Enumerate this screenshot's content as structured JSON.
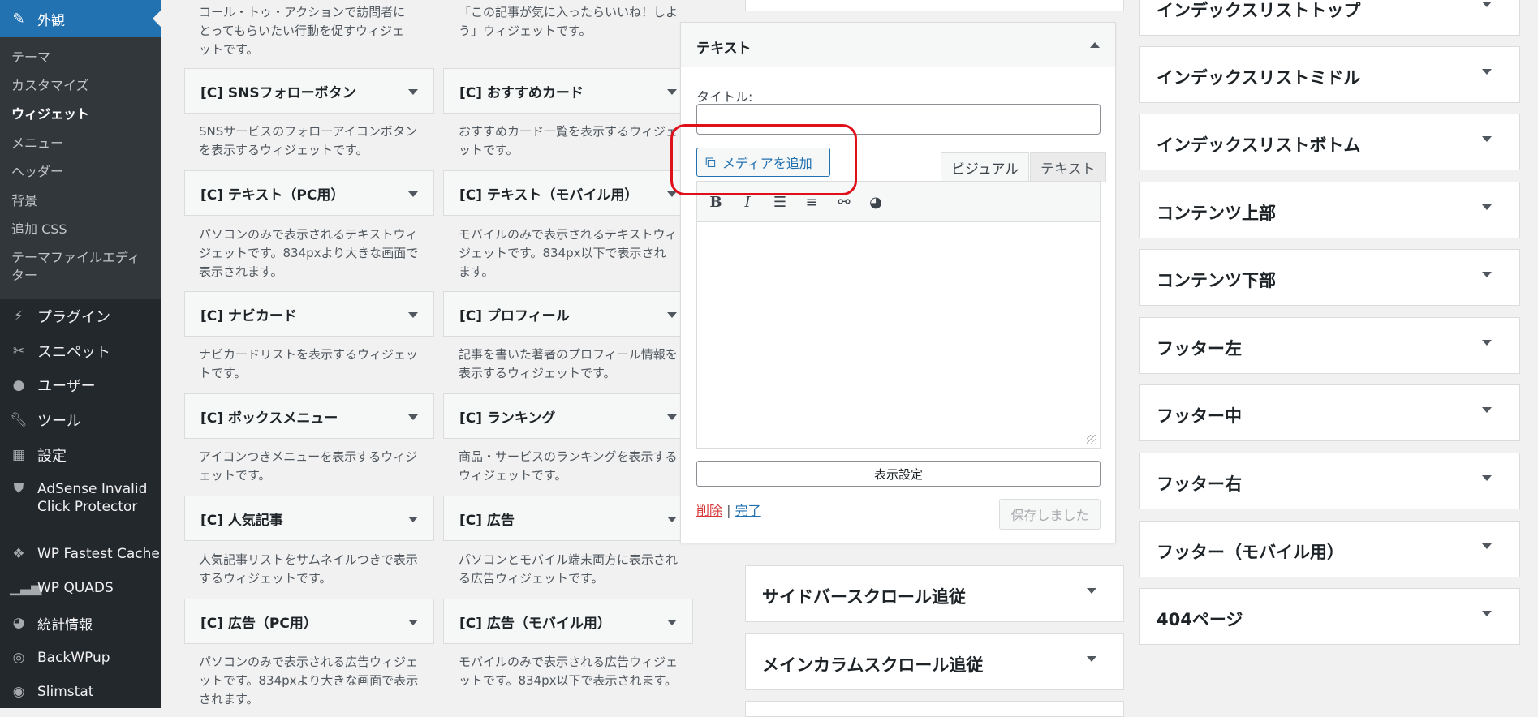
{
  "sidebar": {
    "active": {
      "label": "外観",
      "icon": "paintbrush-icon"
    },
    "submenu": [
      {
        "label": "テーマ"
      },
      {
        "label": "カスタマイズ"
      },
      {
        "label": "ウィジェット",
        "current": true
      },
      {
        "label": "メニュー"
      },
      {
        "label": "ヘッダー"
      },
      {
        "label": "背景"
      },
      {
        "label": "追加 CSS"
      },
      {
        "label": "テーマファイルエディター"
      }
    ],
    "items": [
      {
        "label": "プラグイン",
        "icon": "plugin-icon"
      },
      {
        "label": "スニペット",
        "icon": "scissors-icon"
      },
      {
        "label": "ユーザー",
        "icon": "user-icon"
      },
      {
        "label": "ツール",
        "icon": "wrench-icon"
      },
      {
        "label": "設定",
        "icon": "settings-icon"
      },
      {
        "label": "AdSense Invalid Click Protector",
        "icon": "shield-icon"
      },
      {
        "label": "WP Fastest Cache",
        "icon": "cheetah-icon"
      },
      {
        "label": "WP QUADS",
        "icon": "signal-bars-icon"
      },
      {
        "label": "統計情報",
        "icon": "pie-chart-icon"
      },
      {
        "label": "BackWPup",
        "icon": "backup-icon"
      },
      {
        "label": "Slimstat",
        "icon": "slimstat-icon"
      }
    ]
  },
  "widgets": {
    "top_desc_left": "コール・トゥ・アクションで訪問者にとってもらいたい行動を促すウィジェットです。",
    "top_desc_right": "「この記事が気に入ったらいいね！しよう」ウィジェットです。",
    "rows": [
      {
        "left": {
          "title": "[C] SNSフォローボタン",
          "desc": "SNSサービスのフォローアイコンボタンを表示するウィジェットです。"
        },
        "right": {
          "title": "[C] おすすめカード",
          "desc": "おすすめカード一覧を表示するウィジェットです。"
        }
      },
      {
        "left": {
          "title": "[C] テキスト（PC用）",
          "desc": "パソコンのみで表示されるテキストウィジェットです。834pxより大きな画面で表示されます。"
        },
        "right": {
          "title": "[C] テキスト（モバイル用）",
          "desc": "モバイルのみで表示されるテキストウィジェットです。834px以下で表示されます。"
        }
      },
      {
        "left": {
          "title": "[C] ナビカード",
          "desc": "ナビカードリストを表示するウィジェットです。"
        },
        "right": {
          "title": "[C] プロフィール",
          "desc": "記事を書いた著者のプロフィール情報を表示するウィジェットです。"
        }
      },
      {
        "left": {
          "title": "[C] ボックスメニュー",
          "desc": "アイコンつきメニューを表示するウィジェットです。"
        },
        "right": {
          "title": "[C] ランキング",
          "desc": "商品・サービスのランキングを表示するウィジェットです。"
        }
      },
      {
        "left": {
          "title": "[C] 人気記事",
          "desc": "人気記事リストをサムネイルつきで表示するウィジェットです。"
        },
        "right": {
          "title": "[C] 広告",
          "desc": "パソコンとモバイル端末両方に表示される広告ウィジェットです。"
        }
      },
      {
        "left": {
          "title": "[C] 広告（PC用）",
          "desc": "パソコンのみで表示される広告ウィジェットです。834pxより大きな画面で表示されます。"
        },
        "right": {
          "title": "[C] 広告（モバイル用）",
          "desc": "モバイルのみで表示される広告ウィジェットです。834px以下で表示されます。"
        }
      }
    ]
  },
  "text_widget": {
    "header": "テキスト",
    "title_label": "タイトル:",
    "title_value": "",
    "add_media": "メディアを追加",
    "tab_visual": "ビジュアル",
    "tab_text": "テキスト",
    "toolbar": [
      "bold-icon",
      "italic-icon",
      "bullet-list-icon",
      "numbered-list-icon",
      "link-icon",
      "shortcode-icon"
    ],
    "display_settings": "表示設定",
    "delete": "削除",
    "separator": "|",
    "done": "完了",
    "saved": "保存しました"
  },
  "middle_areas": [
    {
      "title": "サイドバースクロール追従"
    },
    {
      "title": "メインカラムスクロール追従"
    }
  ],
  "right_areas": [
    {
      "title": "インデックスリストトップ"
    },
    {
      "title": "インデックスリストミドル"
    },
    {
      "title": "インデックスリストボトム"
    },
    {
      "title": "コンテンツ上部"
    },
    {
      "title": "コンテンツ下部"
    },
    {
      "title": "フッター左"
    },
    {
      "title": "フッター中"
    },
    {
      "title": "フッター右"
    },
    {
      "title": "フッター（モバイル用）"
    },
    {
      "title": "404ページ"
    }
  ],
  "colors": {
    "sidebar_bg": "#23282d",
    "sidebar_active": "#2271b1",
    "highlight": "#e0101a",
    "link": "#2271b1",
    "delete": "#d63638"
  }
}
